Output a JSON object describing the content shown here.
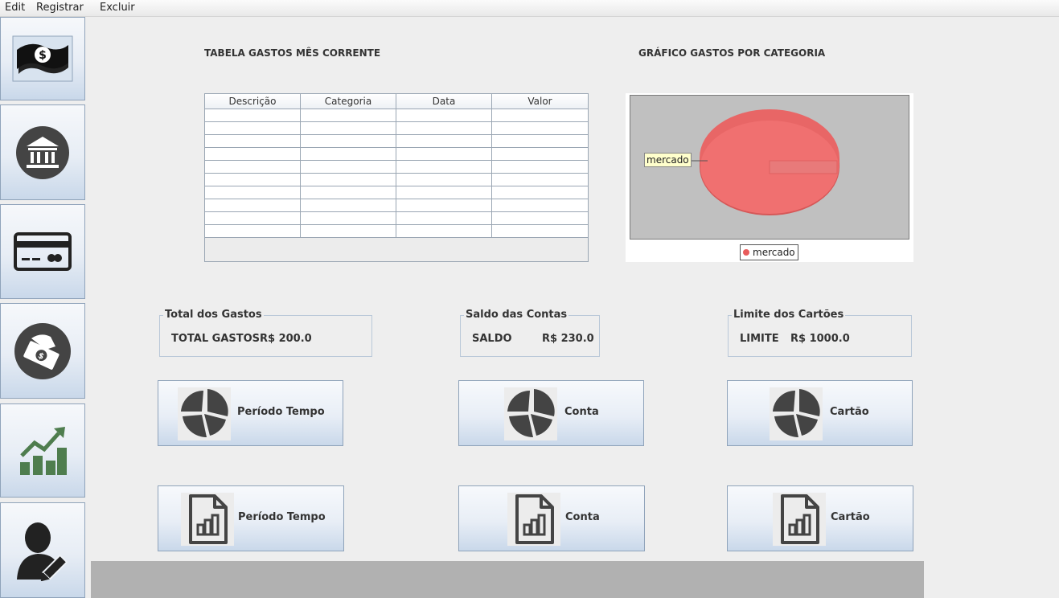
{
  "menu": [
    "Edit",
    "Registrar",
    "Excluir"
  ],
  "sidebar": {
    "items": [
      {
        "icon": "money-icon"
      },
      {
        "icon": "bank-icon"
      },
      {
        "icon": "credit-card-icon"
      },
      {
        "icon": "cash-payment-icon"
      },
      {
        "icon": "growth-chart-icon"
      },
      {
        "icon": "user-edit-icon"
      }
    ]
  },
  "table": {
    "title": "TABELA GASTOS MÊS CORRENTE",
    "columns": [
      "Descrição",
      "Categoria",
      "Data",
      "Valor"
    ],
    "rows": []
  },
  "chart": {
    "title": "GRÁFICO GASTOS POR CATEGORIA"
  },
  "chart_data": {
    "type": "pie",
    "categories": [
      "mercado"
    ],
    "values": [
      100
    ],
    "slice_labels": [
      "mercado"
    ],
    "legend": [
      "mercado"
    ],
    "legend_placement": "bottom",
    "colors": [
      "#e85b5b"
    ]
  },
  "summary": {
    "gastos": {
      "title": "Total dos Gastos",
      "label": "TOTAL GASTOS",
      "value": "R$ 200.0"
    },
    "saldo": {
      "title": "Saldo das Contas",
      "label": "SALDO",
      "value": "R$ 230.0"
    },
    "limite": {
      "title": "Limite dos Cartões",
      "label": "LIMITE",
      "value": "R$ 1000.0"
    }
  },
  "chart_buttons": {
    "periodo": "Período Tempo",
    "conta": "Conta",
    "cartao": "Cartão"
  },
  "report_buttons": {
    "periodo": "Período Tempo",
    "conta": "Conta",
    "cartao": "Cartão"
  }
}
